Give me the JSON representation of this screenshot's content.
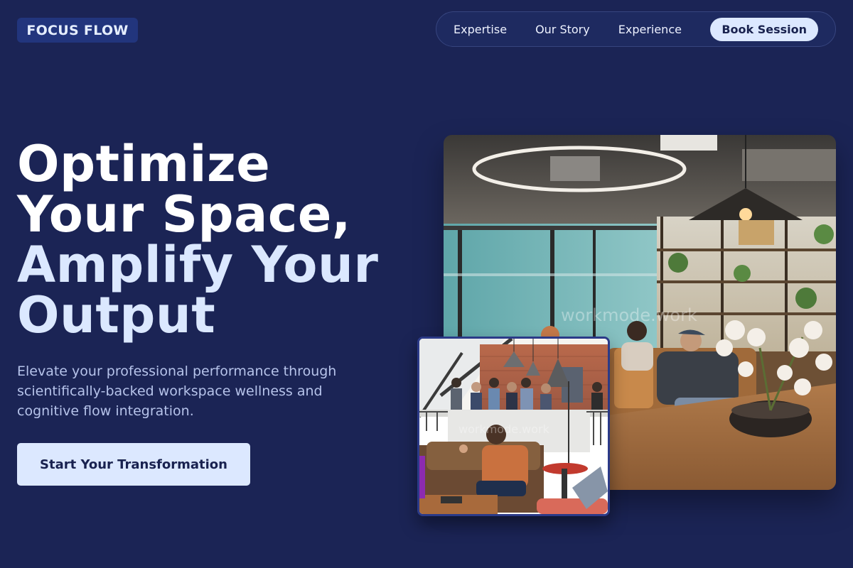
{
  "brand": {
    "logo_text": "FOCUS FLOW"
  },
  "nav": {
    "links": [
      "Expertise",
      "Our Story",
      "Experience"
    ],
    "cta_label": "Book Session"
  },
  "hero": {
    "headline_lines": [
      "Optimize",
      "Your Space,",
      "Amplify Your",
      "Output"
    ],
    "subtext": "Elevate your professional performance through scientifically-backed workspace wellness and cognitive flow integration.",
    "cta_label": "Start Your Transformation"
  },
  "images": {
    "main": {
      "subject": "modern-coworking-lounge-photo",
      "watermark": "workmode.work"
    },
    "small": {
      "subject": "office-meeting-space-photo",
      "watermark": "workmode.work"
    }
  },
  "colors": {
    "background": "#1b2455",
    "accent_light": "#dce8ff",
    "logo_bg": "#22357d",
    "subtext": "#b6c3ea"
  }
}
